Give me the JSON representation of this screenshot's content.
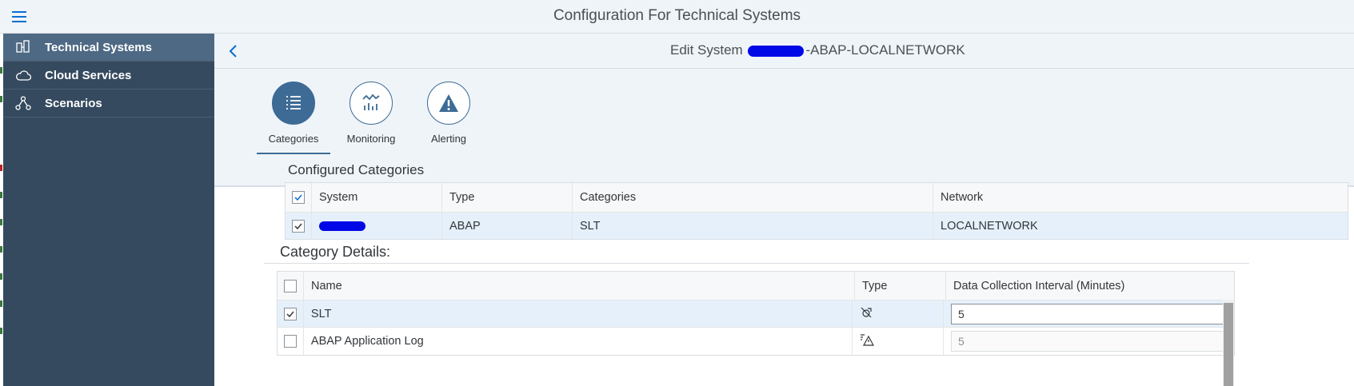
{
  "app": {
    "title": "Configuration For Technical Systems"
  },
  "sidebar": {
    "items": [
      {
        "label": "Technical Systems",
        "icon": "technical-systems-icon",
        "active": true
      },
      {
        "label": "Cloud Services",
        "icon": "cloud-icon",
        "active": false
      },
      {
        "label": "Scenarios",
        "icon": "scenarios-icon",
        "active": false
      }
    ]
  },
  "subheader": {
    "prefix": "Edit System",
    "suffix": "-ABAP-LOCALNETWORK"
  },
  "tabs": [
    {
      "label": "Categories",
      "icon": "list-icon",
      "selected": true
    },
    {
      "label": "Monitoring",
      "icon": "monitoring-icon",
      "selected": false
    },
    {
      "label": "Alerting",
      "icon": "alert-icon",
      "selected": false
    }
  ],
  "configured": {
    "title": "Configured Categories",
    "columns": [
      "System",
      "Type",
      "Categories",
      "Network"
    ],
    "rows": [
      {
        "checked": true,
        "system": "",
        "type": "ABAP",
        "categories": "SLT",
        "network": "LOCALNETWORK"
      }
    ]
  },
  "details": {
    "title": "Category Details:",
    "columns": [
      "Name",
      "Type",
      "Data Collection Interval (Minutes)"
    ],
    "rows": [
      {
        "checked": true,
        "name": "SLT",
        "type_icon": "slt-type-icon",
        "interval": "5",
        "editable": true
      },
      {
        "checked": false,
        "name": "ABAP Application Log",
        "type_icon": "application-log-type-icon",
        "interval": "5",
        "editable": false
      }
    ]
  },
  "colors": {
    "shell": "#354a5f",
    "accent": "#3d6b95",
    "selected_row": "#e5f0fa",
    "redaction": "#0008e8"
  }
}
